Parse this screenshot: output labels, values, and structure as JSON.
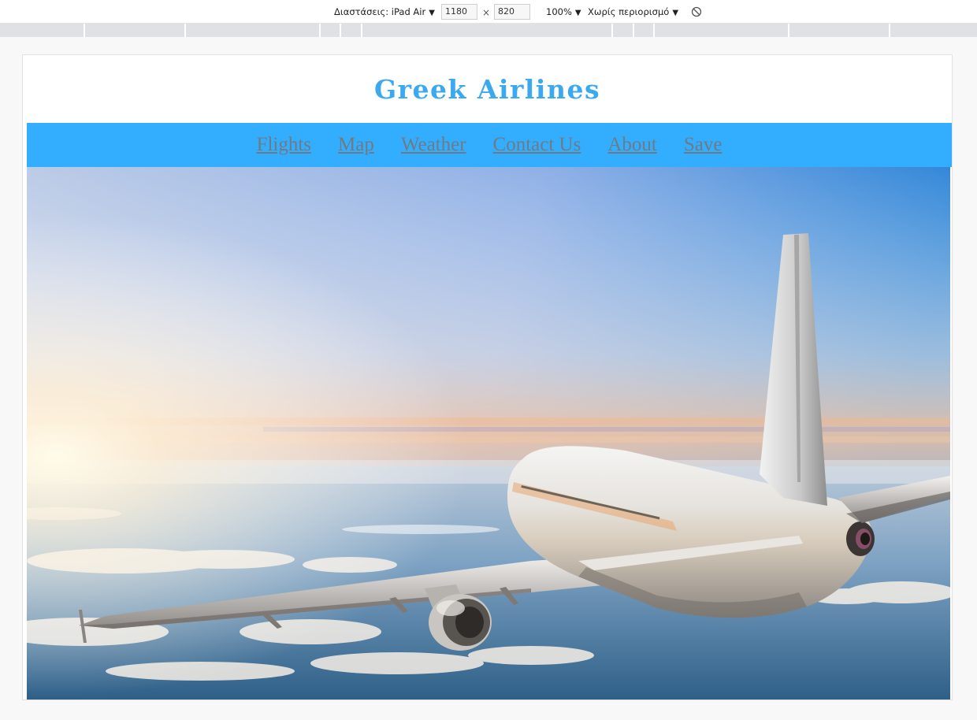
{
  "devtools": {
    "device_label": "Διαστάσεις: iPad Air",
    "width_value": "1180",
    "times_symbol": "×",
    "height_value": "820",
    "zoom": "100%",
    "throttling": "Χωρίς περιορισμό",
    "dropdown_icon": "caret-down-icon",
    "rotate_icon": "rotate-icon"
  },
  "site": {
    "title": "Greek Airlines",
    "title_color": "#3aa9f0",
    "nav_color": "#33aeff",
    "nav_items": [
      "Flights",
      "Map",
      "Weather",
      "Contact Us",
      "About",
      "Save"
    ]
  },
  "hero": {
    "image_subject": "airplane-above-clouds-at-sunset"
  }
}
